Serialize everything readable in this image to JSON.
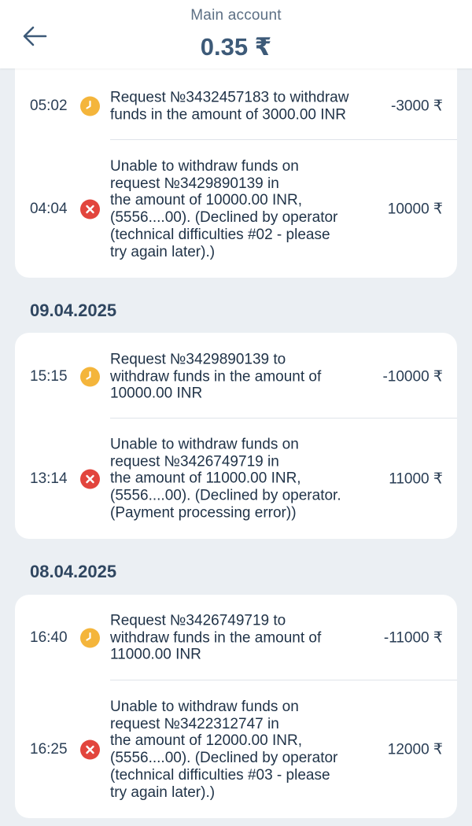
{
  "header": {
    "title": "Main account",
    "balance": "0.35 ₹"
  },
  "colors": {
    "pending": "#f4b53b",
    "declined": "#e2453d",
    "background": "#ebeff3"
  },
  "groups": [
    {
      "date": "",
      "items": [
        {
          "time": "05:02",
          "status": "pending",
          "status_icon": "clock-icon",
          "description": "Request №3432457183 to withdraw\nfunds in the amount of 3000.00 INR",
          "amount": "-3000 ₹"
        },
        {
          "time": "04:04",
          "status": "declined",
          "status_icon": "close-icon",
          "description": "Unable to withdraw funds on\nrequest №3429890139 in\nthe amount of 10000.00 INR,\n (5556....00). (Declined by operator\n(technical difficulties #02 - please\ntry again later).)",
          "amount": "10000 ₹"
        }
      ]
    },
    {
      "date": "09.04.2025",
      "items": [
        {
          "time": "15:15",
          "status": "pending",
          "status_icon": "clock-icon",
          "description": "Request №3429890139 to\nwithdraw funds in the amount of\n10000.00 INR",
          "amount": "-10000 ₹"
        },
        {
          "time": "13:14",
          "status": "declined",
          "status_icon": "close-icon",
          "description": "Unable to withdraw funds on\nrequest №3426749719 in\nthe amount of 11000.00 INR,\n (5556....00). (Declined by operator.\n(Payment processing error))",
          "amount": "11000 ₹"
        }
      ]
    },
    {
      "date": "08.04.2025",
      "items": [
        {
          "time": "16:40",
          "status": "pending",
          "status_icon": "clock-icon",
          "description": "Request №3426749719 to\nwithdraw funds in the amount of\n11000.00 INR",
          "amount": "-11000 ₹"
        },
        {
          "time": "16:25",
          "status": "declined",
          "status_icon": "close-icon",
          "description": "Unable to withdraw funds on\nrequest №3422312747 in\nthe amount of 12000.00 INR,\n (5556....00). (Declined by operator\n(technical difficulties #03 - please\ntry again later).)",
          "amount": "12000 ₹"
        }
      ]
    }
  ]
}
